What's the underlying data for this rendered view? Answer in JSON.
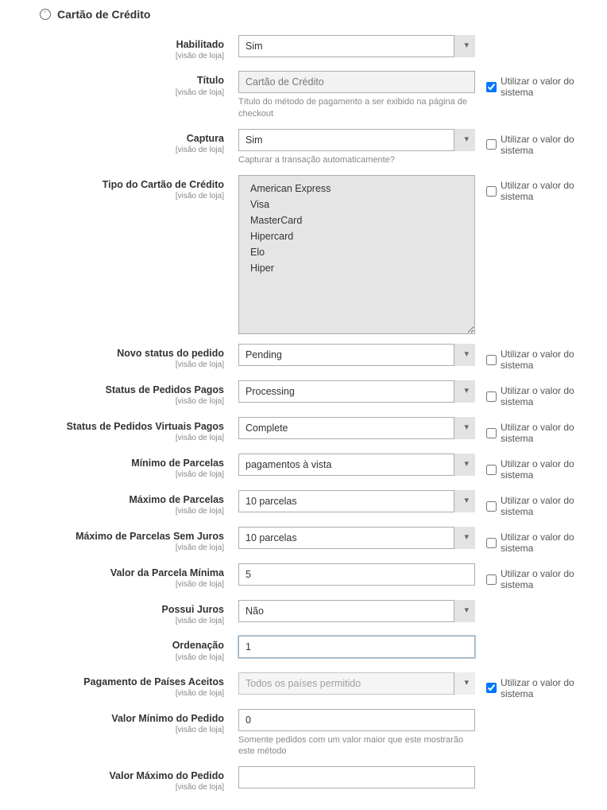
{
  "section": {
    "title": "Cartão de Crédito"
  },
  "common": {
    "scope": "[visão de loja]",
    "system_value_label": "Utilizar o valor do sistema"
  },
  "fields": {
    "enabled": {
      "label": "Habilitado",
      "value": "Sim"
    },
    "title": {
      "label": "Título",
      "value": "Cartão de Crédito",
      "hint": "Título do método de pagamento a ser exibido na página de checkout",
      "system_checked": true
    },
    "capture": {
      "label": "Captura",
      "value": "Sim",
      "hint": "Capturar a transação automaticamente?",
      "system_checked": false
    },
    "cc_types": {
      "label": "Tipo do Cartão de Crédito",
      "items": [
        "American Express",
        "Visa",
        "MasterCard",
        "Hipercard",
        "Elo",
        "Hiper"
      ],
      "system_checked": false
    },
    "new_status": {
      "label": "Novo status do pedido",
      "value": "Pending",
      "system_checked": false
    },
    "paid_status": {
      "label": "Status de Pedidos Pagos",
      "value": "Processing",
      "system_checked": false
    },
    "virtual_status": {
      "label": "Status de Pedidos Virtuais Pagos",
      "value": "Complete",
      "system_checked": false
    },
    "min_install": {
      "label": "Mínimo de Parcelas",
      "value": "pagamentos à vista",
      "system_checked": false
    },
    "max_install": {
      "label": "Máximo de Parcelas",
      "value": "10 parcelas",
      "system_checked": false
    },
    "max_install_nofee": {
      "label": "Máximo de Parcelas Sem Juros",
      "value": "10 parcelas",
      "system_checked": false
    },
    "min_install_value": {
      "label": "Valor da Parcela Mínima",
      "value": "5",
      "system_checked": false
    },
    "has_fee": {
      "label": "Possui Juros",
      "value": "Não"
    },
    "sort": {
      "label": "Ordenação",
      "value": "1"
    },
    "countries": {
      "label": "Pagamento de Países Aceitos",
      "value": "Todos os países permitido",
      "system_checked": true
    },
    "min_order": {
      "label": "Valor Mínimo do Pedido",
      "value": "0",
      "hint": "Somente pedidos com um valor maior que este mostrarão este método"
    },
    "max_order": {
      "label": "Valor Máximo do Pedido",
      "value": ""
    }
  }
}
